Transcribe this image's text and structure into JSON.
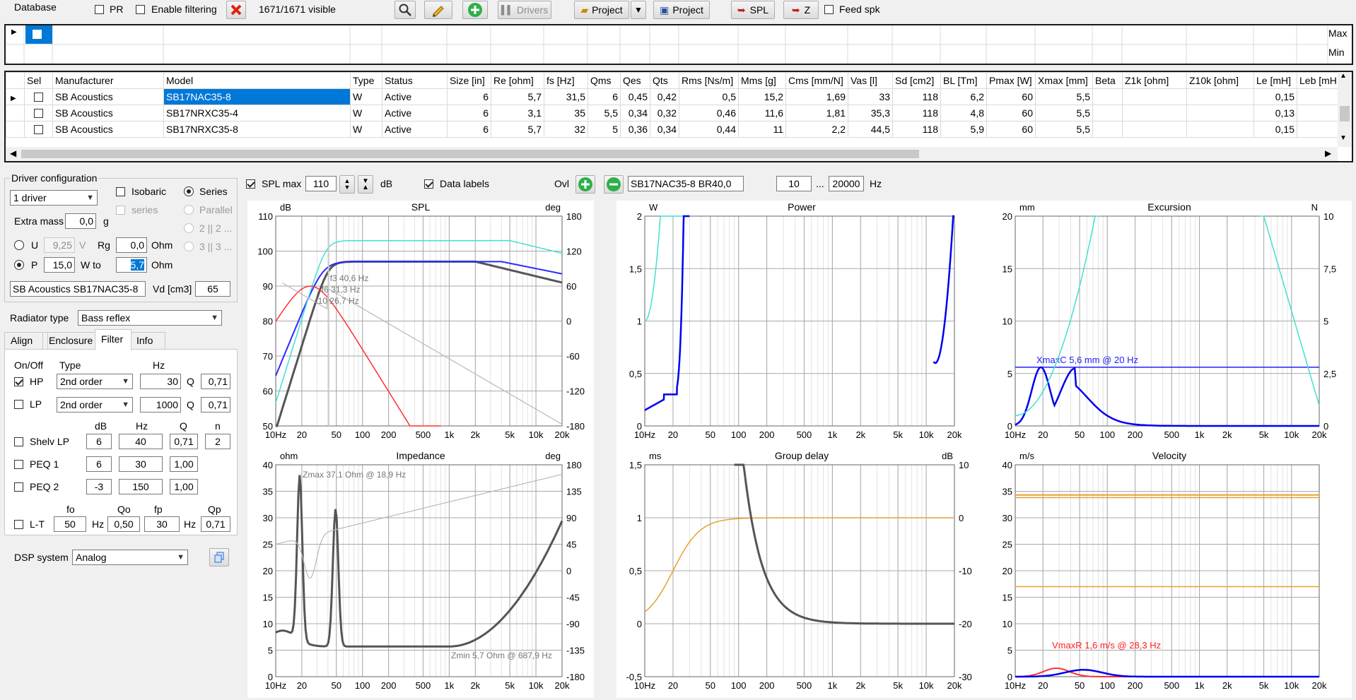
{
  "toolbar": {
    "database_label": "Database",
    "pr_label": "PR",
    "enable_filtering_label": "Enable filtering",
    "visible_count": "1671/1671 visible",
    "drivers_label": "Drivers",
    "project_label": "Project",
    "project2_label": "Project",
    "spl_label": "SPL",
    "z_label": "Z",
    "feed_spk_label": "Feed spk"
  },
  "filter_grid": {
    "max_label": "Max",
    "min_label": "Min"
  },
  "table": {
    "headers": [
      "Sel",
      "Manufacturer",
      "Model",
      "Type",
      "Status",
      "Size [in]",
      "Re [ohm]",
      "fs [Hz]",
      "Qms",
      "Qes",
      "Qts",
      "Rms [Ns/m]",
      "Mms [g]",
      "Cms [mm/N]",
      "Vas [l]",
      "Sd [cm2]",
      "BL [Tm]",
      "Pmax [W]",
      "Xmax [mm]",
      "Beta",
      "Z1k [ohm]",
      "Z10k [ohm]",
      "Le [mH]",
      "Leb [mH"
    ],
    "rows": [
      [
        "",
        "SB Acoustics",
        "SB17NAC35-8",
        "W",
        "Active",
        "6",
        "5,7",
        "31,5",
        "6",
        "0,45",
        "0,42",
        "0,5",
        "15,2",
        "1,69",
        "33",
        "118",
        "6,2",
        "60",
        "5,5",
        "",
        "",
        "",
        "0,15",
        ""
      ],
      [
        "",
        "SB Acoustics",
        "SB17NRXC35-4",
        "W",
        "Active",
        "6",
        "3,1",
        "35",
        "5,5",
        "0,34",
        "0,32",
        "0,46",
        "11,6",
        "1,81",
        "35,3",
        "118",
        "4,8",
        "60",
        "5,5",
        "",
        "",
        "",
        "0,13",
        ""
      ],
      [
        "",
        "SB Acoustics",
        "SB17NRXC35-8",
        "W",
        "Active",
        "6",
        "5,7",
        "32",
        "5",
        "0,36",
        "0,34",
        "0,44",
        "11",
        "2,2",
        "44,5",
        "118",
        "5,9",
        "60",
        "5,5",
        "",
        "",
        "",
        "0,15",
        ""
      ]
    ]
  },
  "driver_config": {
    "title": "Driver configuration",
    "drivers_count": "1 driver",
    "isobaric_label": "Isobaric",
    "series_label": "Series",
    "series_sub_label": "series",
    "parallel_label": "Parallel",
    "opt_2x2": "2 || 2 ...",
    "opt_3x3": "3 || 3 ...",
    "extra_mass_label": "Extra mass",
    "extra_mass_value": "0,0",
    "extra_mass_unit": "g",
    "u_label": "U",
    "u_value": "9,25",
    "u_unit": "V",
    "rg_label": "Rg",
    "rg_value": "0,0",
    "rg_unit": "Ohm",
    "p_label": "P",
    "p_value": "15,0",
    "p_unit": "W to",
    "p_ohm_value": "5,7",
    "p_ohm_unit": "Ohm",
    "driver_name": "SB Acoustics SB17NAC35-8",
    "vd_label": "Vd [cm3]",
    "vd_value": "65",
    "radiator_label": "Radiator type",
    "radiator_value": "Bass reflex"
  },
  "tabs": [
    "Align",
    "Enclosure",
    "Filter",
    "Info"
  ],
  "filter_panel": {
    "onoff_header": "On/Off",
    "type_header": "Type",
    "hz_header": "Hz",
    "hp_label": "HP",
    "hp_type": "2nd order",
    "hp_hz": "30",
    "hp_q_label": "Q",
    "hp_q": "0,71",
    "lp_label": "LP",
    "lp_type": "2nd order",
    "lp_hz": "1000",
    "lp_q_label": "Q",
    "lp_q": "0,71",
    "col_db": "dB",
    "col_hz": "Hz",
    "col_q": "Q",
    "col_n": "n",
    "shelv_label": "Shelv LP",
    "shelv_db": "6",
    "shelv_hz": "40",
    "shelv_q": "0,71",
    "shelv_n": "2",
    "peq1_label": "PEQ 1",
    "peq1_db": "6",
    "peq1_hz": "30",
    "peq1_q": "1,00",
    "peq2_label": "PEQ 2",
    "peq2_db": "-3",
    "peq2_hz": "150",
    "peq2_q": "1,00",
    "lt_fo_header": "fo",
    "lt_qo_header": "Qo",
    "lt_fp_header": "fp",
    "lt_qp_header": "Qp",
    "lt_label": "L-T",
    "lt_fo": "50",
    "lt_hz1": "Hz",
    "lt_qo": "0,50",
    "lt_fp": "30",
    "lt_hz2": "Hz",
    "lt_qp": "0,71",
    "dsp_label": "DSP system",
    "dsp_value": "Analog"
  },
  "graph_toolbar": {
    "spl_max_label": "SPL max",
    "spl_max_value": "110",
    "db_unit": "dB",
    "data_labels_label": "Data labels",
    "ovl_label": "Ovl",
    "project_name": "SB17NAC35-8 BR40,0",
    "f_min": "10",
    "dots": "...",
    "f_max": "20000",
    "hz_unit": "Hz"
  },
  "charts": {
    "x_ticks": [
      "10Hz",
      "20",
      "50",
      "100",
      "200",
      "500",
      "1k",
      "2k",
      "5k",
      "10k",
      "20k"
    ],
    "spl": {
      "title": "SPL",
      "left_unit": "dB",
      "right_unit": "deg",
      "y_left": [
        "110",
        "100",
        "90",
        "80",
        "70",
        "60",
        "50"
      ],
      "y_right": [
        "180",
        "120",
        "60",
        "0",
        "-60",
        "-120",
        "-180"
      ],
      "labels": [
        "f3 40,6 Hz",
        "f6 31,3 Hz",
        "f10 26,7 Hz"
      ]
    },
    "power": {
      "title": "Power",
      "left_unit": "W",
      "y_left": [
        "2",
        "1,5",
        "1",
        "0,5",
        "0"
      ]
    },
    "excursion": {
      "title": "Excursion",
      "left_unit": "mm",
      "right_unit": "N",
      "y_left": [
        "20",
        "15",
        "10",
        "5",
        "0"
      ],
      "y_right": [
        "10",
        "7,5",
        "5",
        "2,5",
        "0"
      ],
      "label": "XmaxC 5,6 mm  @ 20 Hz"
    },
    "impedance": {
      "title": "Impedance",
      "left_unit": "ohm",
      "right_unit": "deg",
      "y_left": [
        "40",
        "35",
        "30",
        "25",
        "20",
        "15",
        "10",
        "5",
        "0"
      ],
      "y_right": [
        "180",
        "135",
        "90",
        "45",
        "0",
        "-45",
        "-90",
        "-135",
        "-180"
      ],
      "label_max": "Zmax 37,1 Ohm @ 18,9 Hz",
      "label_min": "Zmin 5,7 Ohm @ 687,9 Hz"
    },
    "group_delay": {
      "title": "Group delay",
      "left_unit": "ms",
      "right_unit": "dB",
      "y_left": [
        "1,5",
        "1",
        "0,5",
        "0",
        "-0,5"
      ],
      "y_right": [
        "10",
        "0",
        "-10",
        "-20",
        "-30"
      ]
    },
    "velocity": {
      "title": "Velocity",
      "left_unit": "m/s",
      "y_left": [
        "40",
        "35",
        "30",
        "25",
        "20",
        "15",
        "10",
        "5",
        "0"
      ],
      "label": "VmaxR 1,6 m/s @ 28,3 Hz"
    }
  },
  "colors": {
    "accent": "#0000ff",
    "cyan": "#40e0d0",
    "red": "#ff3030",
    "gray": "#555555",
    "orange": "#e8a030",
    "selection": "#0078d7"
  }
}
